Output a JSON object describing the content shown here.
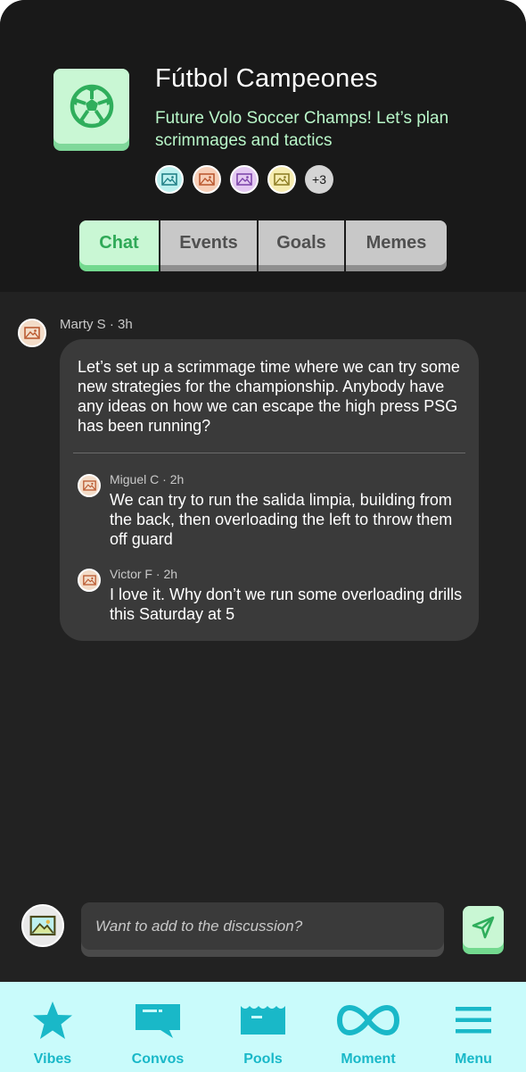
{
  "group": {
    "title": "Fútbol Campeones",
    "description": "Future Volo Soccer Champs! Let’s plan scrimmages and tactics",
    "icon": "soccer-ball-icon",
    "members_more": "+3",
    "member_colors": [
      "#bdf0ef",
      "#f7cfb8",
      "#e4c9f2",
      "#f6ecb0"
    ]
  },
  "tabs": [
    {
      "label": "Chat",
      "active": true
    },
    {
      "label": "Events",
      "active": false
    },
    {
      "label": "Goals",
      "active": false
    },
    {
      "label": "Memes",
      "active": false
    }
  ],
  "thread": {
    "author": "Marty S",
    "time": "3h",
    "text": "Let’s set up a scrimmage time where we can try some new strategies for the championship. Anybody have any ideas on how we can escape the high press PSG has been running?",
    "replies": [
      {
        "author": "Miguel C",
        "time": "2h",
        "text": "We can try to run the salida limpia, building from the back, then overloading the left to throw them off guard"
      },
      {
        "author": "Victor F",
        "time": "2h",
        "text": "I love it. Why don’t we run some overloading drills this Saturday at 5"
      }
    ]
  },
  "composer": {
    "placeholder": "Want to add to the discussion?"
  },
  "nav": [
    {
      "label": "Vibes",
      "icon": "star-icon"
    },
    {
      "label": "Convos",
      "icon": "chat-bubble-icon"
    },
    {
      "label": "Pools",
      "icon": "pool-icon"
    },
    {
      "label": "Moment",
      "icon": "infinity-icon"
    },
    {
      "label": "Menu",
      "icon": "menu-icon"
    }
  ],
  "colors": {
    "accent_green": "#73d98f",
    "accent_cyan": "#19b8c8",
    "background": "#222222"
  }
}
